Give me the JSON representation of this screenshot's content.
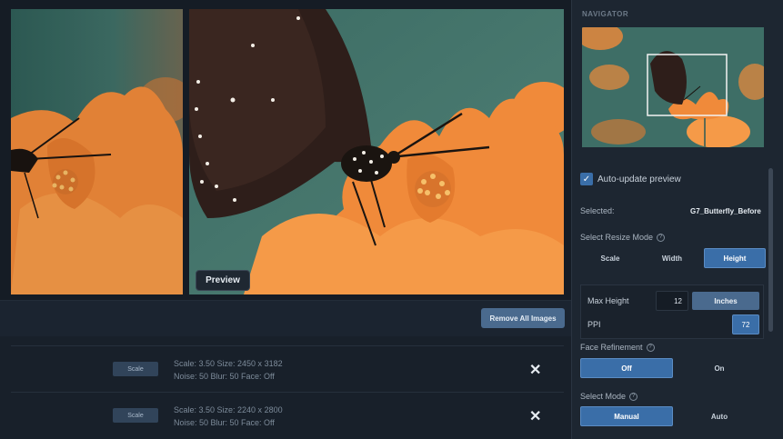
{
  "image": {
    "preview_label": "Preview"
  },
  "toolbar": {
    "remove_all_label": "Remove All Images"
  },
  "list": {
    "rows": [
      {
        "button": "Scale",
        "line1": "Scale: 3.50  Size: 2450 x 3182",
        "line2": "Noise: 50  Blur: 50  Face: Off",
        "close": "✕"
      },
      {
        "button": "Scale",
        "line1": "Scale: 3.50  Size: 2240 x 2800",
        "line2": "Noise: 50  Blur: 50  Face: Off",
        "close": "✕"
      }
    ]
  },
  "sidebar": {
    "navigator_title": "NAVIGATOR",
    "auto_update": {
      "checked": true,
      "label": "Auto-update preview"
    },
    "selected_label": "Selected:",
    "selected_value": "G7_Butterfly_Before",
    "resize_mode": {
      "label": "Select Resize Mode",
      "options": [
        "Scale",
        "Width",
        "Height"
      ],
      "active": "Height"
    },
    "max_height": {
      "label": "Max Height",
      "value": "12",
      "unit": "Inches"
    },
    "ppi": {
      "label": "PPI",
      "value": "72"
    },
    "face_refinement": {
      "label": "Face Refinement",
      "options": [
        "Off",
        "On"
      ],
      "active": "Off"
    },
    "select_mode": {
      "label": "Select Mode",
      "options": [
        "Manual",
        "Auto"
      ],
      "active": "Manual"
    }
  },
  "colors": {
    "accent": "#3a6ea8",
    "panel": "#1d2631",
    "flower": "#f08a3a",
    "background_teal": "#3e6e66"
  }
}
